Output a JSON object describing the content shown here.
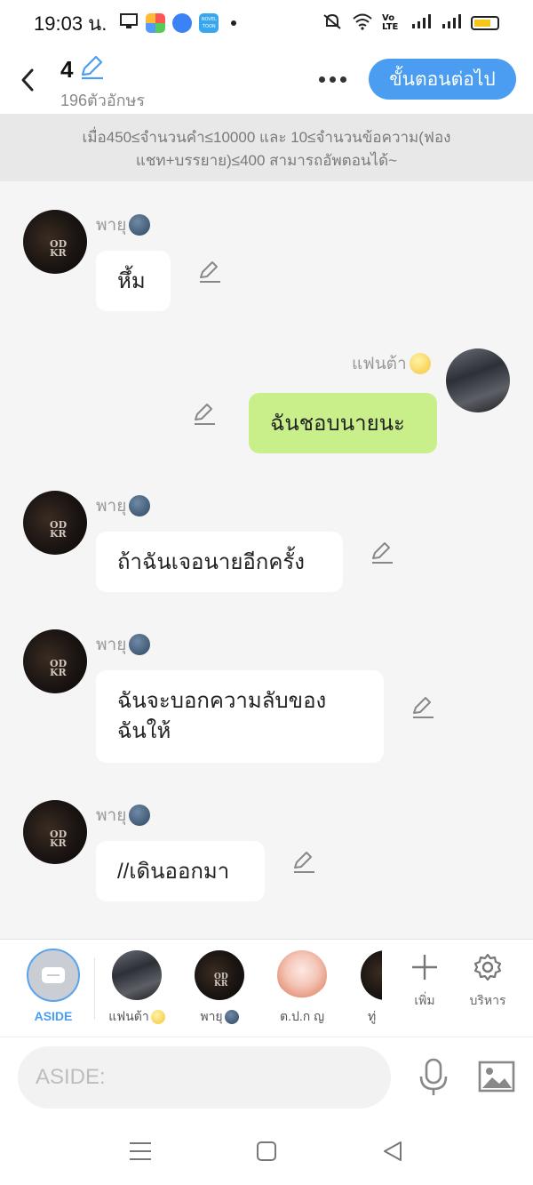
{
  "status_bar": {
    "time": "19:03 น.",
    "volte_label": "Vo LTE",
    "app_badge": "NOVEL TOON"
  },
  "header": {
    "title": "4",
    "char_count": "196ตัวอักษร",
    "next_button": "ขั้นตอนต่อไป"
  },
  "notice": {
    "line1": "เมื่อ450≤จำนวนคำ≤10000 และ 10≤จำนวนข้อความ(ฟอง",
    "line2": "แชท+บรรยาย)≤400 สามารถอัพตอนได้~"
  },
  "messages": [
    {
      "sender": "พายุ",
      "text": "หึ้ม",
      "side": "left",
      "sender_emoji": "dark-moon-emoji"
    },
    {
      "sender": "แฟนต้า",
      "text": "ฉันชอบนายนะ",
      "side": "right",
      "sender_emoji": "sun-face-emoji"
    },
    {
      "sender": "พายุ",
      "text": "ถ้าฉันเจอนายอีกครั้ง",
      "side": "left",
      "sender_emoji": "dark-moon-emoji"
    },
    {
      "sender": "พายุ",
      "text_line1": "ฉันจะบอกความลับของ",
      "text_line2": "ฉันให้",
      "side": "left",
      "sender_emoji": "dark-moon-emoji"
    },
    {
      "sender": "พายุ",
      "text": "//เดินออกมา",
      "side": "left",
      "sender_emoji": "dark-moon-emoji"
    }
  ],
  "char_bar": {
    "aside_label": "ASIDE",
    "characters": [
      {
        "name": "แฟนต้า",
        "emoji": "sun-face-emoji"
      },
      {
        "name": "พายุ",
        "emoji": "dark-moon-emoji"
      },
      {
        "name": "ต.ป.ก ญ",
        "emoji": ""
      },
      {
        "name": "ทู่",
        "emoji": ""
      }
    ],
    "add_label": "เพิ่ม",
    "manage_label": "บริหาร"
  },
  "input": {
    "placeholder": "ASIDE:"
  },
  "colors": {
    "accent": "#4a9df0",
    "green_bubble": "#c8ef8a",
    "notice_bg": "#e8e8e8"
  }
}
